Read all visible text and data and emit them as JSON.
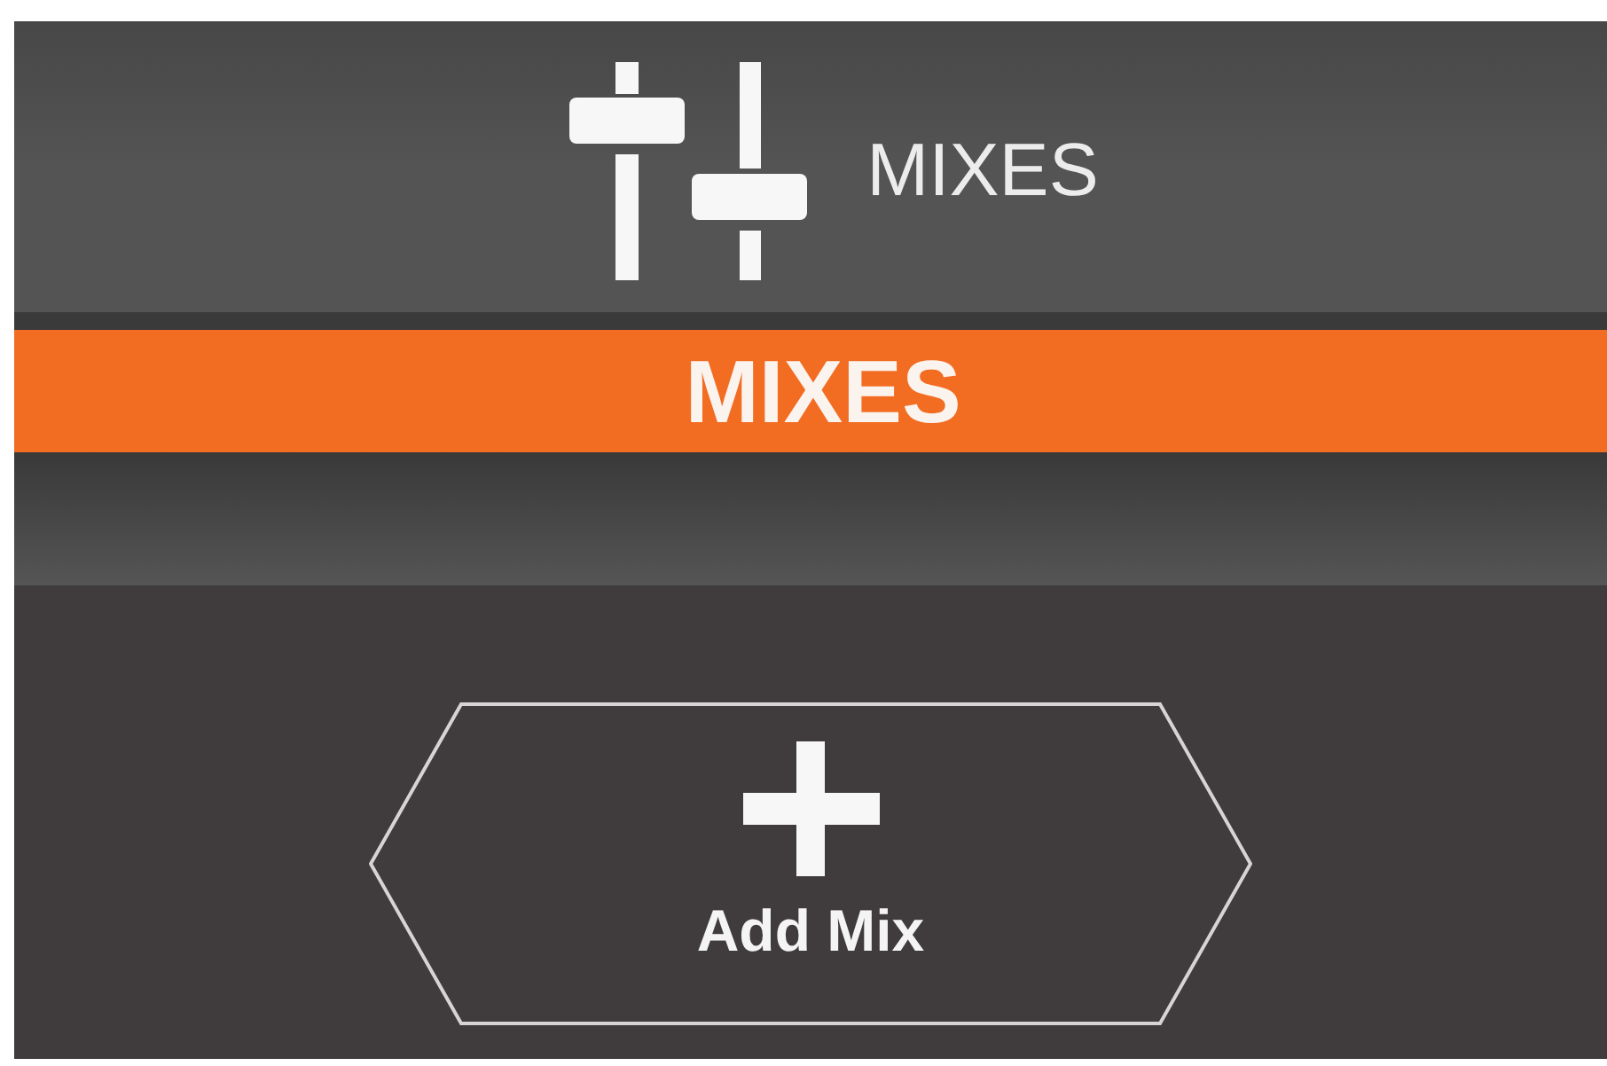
{
  "header": {
    "title": "MIXES"
  },
  "section_bar": {
    "title": "MIXES"
  },
  "actions": [
    {
      "kind": "add",
      "label": "Add Mix"
    }
  ]
}
